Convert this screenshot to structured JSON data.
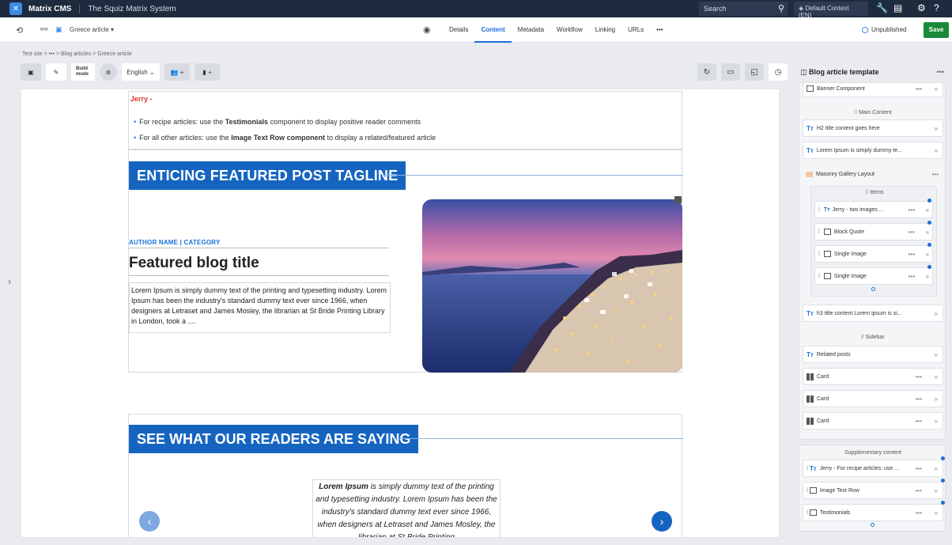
{
  "topbar": {
    "brand": "Matrix CMS",
    "system": "The Squiz Matrix System",
    "search_placeholder": "Search",
    "context": "Default Context (EN)"
  },
  "toolbar": {
    "asset_name": "Greece article",
    "tabs": [
      "Details",
      "Content",
      "Metadata",
      "Workflow",
      "Linking",
      "URLs",
      "•••"
    ],
    "active_tab": "Content",
    "status": "Unpublished",
    "save_label": "Save"
  },
  "breadcrumb": [
    "Test site",
    "•••",
    "Blog articles",
    "Greece article"
  ],
  "buildbar": {
    "build_mode": "Build mode",
    "language": "English"
  },
  "content": {
    "jerry": "Jerry -",
    "bullet1_pre": "For recipe articles: use the ",
    "bullet1_bold": "Testimonials",
    "bullet1_post": " component to display positive reader comments",
    "bullet2_pre": "For all other articles: use the ",
    "bullet2_bold": "Image Text Row component",
    "bullet2_post": " to display a related/featured article",
    "tagline": "ENTICING FEATURED POST TAGLINE",
    "author": "AUTHOR NAME | CATEGORY",
    "featured_title": "Featured blog title",
    "body": "Lorem Ipsum is simply dummy text of the printing and typesetting industry. Lorem Ipsum has been the industry's standard dummy text ever since 1966, when designers at Letraset and James Mosley, the librarian at St Bride Printing Library in London, took a ....",
    "tagline2": "SEE WHAT OUR READERS ARE SAYING",
    "quote_bold": "Lorem Ipsum",
    "quote_rest": " is simply dummy text of the printing and typesetting industry. Lorem Ipsum has been the industry's standard dummy text ever since 1966, when designers at Letraset and James Mosley, the librarian at St Bride Printing"
  },
  "panel": {
    "title": "Blog article template",
    "banner": "Banner Component",
    "main_content": "Main Content",
    "h2": "H2 title content goes here",
    "lorem": "Lorem Ipsum is simply dummy te...",
    "masonry": "Masonry Gallery Layout",
    "items": "Items",
    "item1": "Jerry - two images ...",
    "item2": "Block Quote",
    "item3": "Single Image",
    "item4": "Single Image",
    "h3": "h3 title content Lorem ipsum is si...",
    "sidebar": "Sidebar",
    "related": "Related posts",
    "card": "Card",
    "supplementary": "Supplementary content",
    "sup1": "Jerry - For recipe articles: use ...",
    "sup2": "Image Text Row",
    "sup3": "Testimonials"
  },
  "colors": {
    "brand_blue": "#1565c0",
    "save_green": "#1a8a3a",
    "topbar": "#1e2a3d"
  }
}
